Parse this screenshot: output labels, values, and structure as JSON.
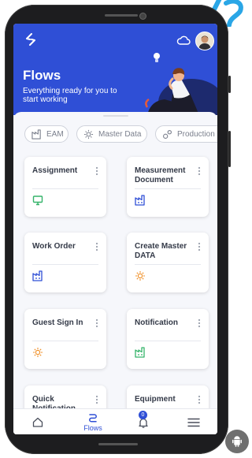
{
  "header": {
    "title": "Flows",
    "subtitle": "Everything ready for you to start working"
  },
  "categories": [
    {
      "label": "EAM",
      "icon": "factory-icon"
    },
    {
      "label": "Master Data",
      "icon": "lightbulb-icon"
    },
    {
      "label": "Production",
      "icon": "gears-icon"
    }
  ],
  "flows": [
    {
      "name": "Assignment",
      "icon": "monitor-icon",
      "icon_color": "#35b36a"
    },
    {
      "name": "Measurement Document",
      "icon": "factory-icon",
      "icon_color": "#2f4fd6"
    },
    {
      "name": "Work Order",
      "icon": "factory-icon",
      "icon_color": "#2f4fd6"
    },
    {
      "name": "Create Master DATA",
      "icon": "lightbulb-icon",
      "icon_color": "#f0922b"
    },
    {
      "name": "Guest Sign In",
      "icon": "lightbulb-icon",
      "icon_color": "#f0922b"
    },
    {
      "name": "Notification",
      "icon": "factory-icon",
      "icon_color": "#35b36a"
    },
    {
      "name": "Quick Notification",
      "icon": "",
      "icon_color": ""
    },
    {
      "name": "Equipment",
      "icon": "",
      "icon_color": ""
    }
  ],
  "nav": {
    "flows_label": "Flows",
    "notification_count": "0"
  },
  "colors": {
    "brand_blue": "#2f4fd6",
    "deco_cyan": "#2aa6e6",
    "card_bg": "#ffffff",
    "screen_bg": "#f6f7fb"
  }
}
